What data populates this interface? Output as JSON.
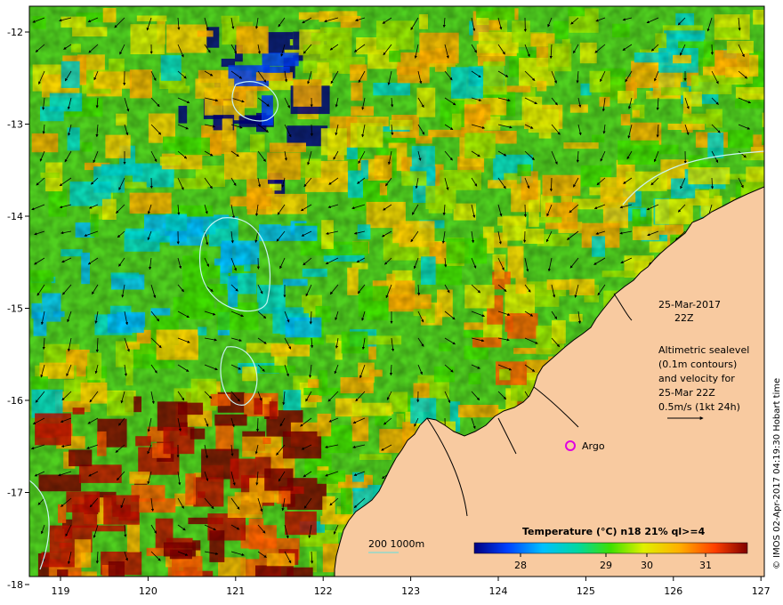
{
  "colors": {
    "land": "#f8caa0",
    "coast": "#000000",
    "contour": "#c8f4f4",
    "argo": "#e000e0",
    "bathy": "#60e0e0"
  },
  "axes": {
    "lon_ticks": [
      "119",
      "120",
      "121",
      "122",
      "123",
      "124",
      "125",
      "126",
      "127"
    ],
    "lat_ticks": [
      "-12",
      "-13",
      "-14",
      "-15",
      "-16",
      "-17",
      "-18"
    ]
  },
  "annotation": {
    "date": "25-Mar-2017",
    "time": "22Z",
    "desc_1": "Altimetric sealevel",
    "desc_2": "(0.1m contours)",
    "desc_3": "and velocity for",
    "desc_4": "25-Mar 22Z",
    "desc_5": "0.5m/s (1kt 24h)"
  },
  "argo": {
    "label": "Argo"
  },
  "bathymetry": {
    "label": "200  1000m"
  },
  "colorbar": {
    "title": "Temperature (°C) n18 21% ql>=4",
    "ticks": [
      "28",
      "29",
      "30",
      "31"
    ]
  },
  "credit": "© IMOS 02-Apr-2017 04:19:30 Hobart time"
}
